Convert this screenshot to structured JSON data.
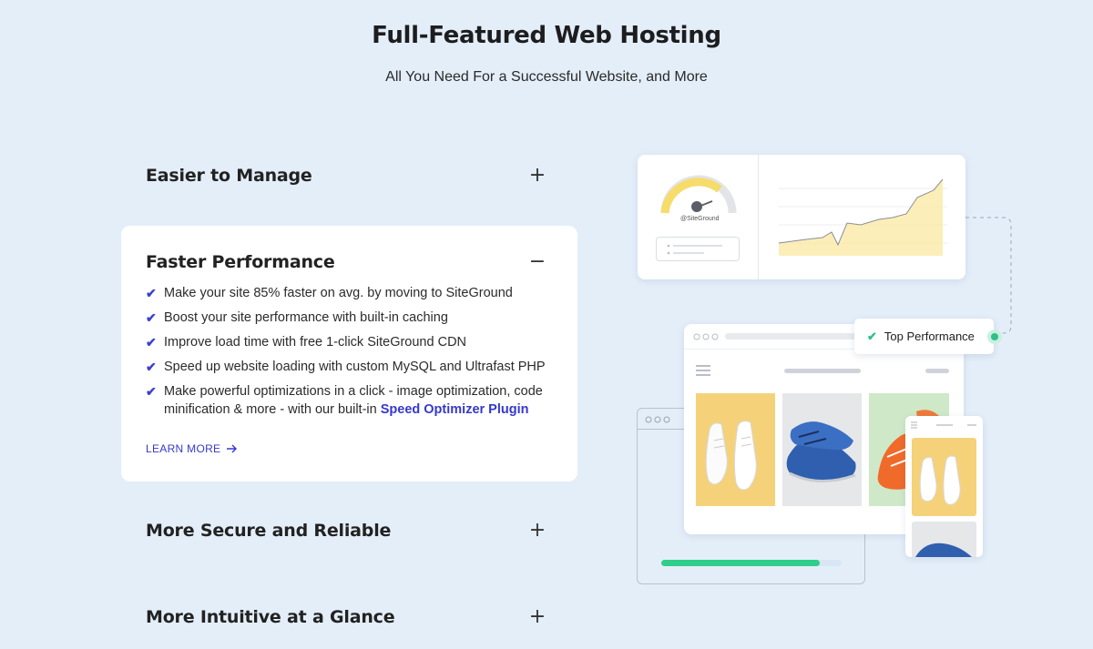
{
  "header": {
    "title": "Full-Featured Web Hosting",
    "subtitle": "All You Need For a Successful Website, and More"
  },
  "accordion": [
    {
      "title": "Easier to Manage",
      "sign": "+"
    },
    {
      "title": "Faster Performance",
      "sign": "−"
    },
    {
      "title": "More Secure and Reliable",
      "sign": "+"
    },
    {
      "title": "More Intuitive at a Glance",
      "sign": "+"
    }
  ],
  "expanded": {
    "features": [
      "Make your site 85% faster on avg. by moving to SiteGround",
      "Boost your site performance with built-in caching",
      "Improve load time with free 1-click SiteGround CDN",
      "Speed up website loading with custom MySQL and Ultrafast PHP"
    ],
    "last_feature_prefix": "Make powerful optimizations in a click - image optimization, code minification & more - with our built-in ",
    "last_feature_link": "Speed Optimizer Plugin",
    "learn_more": "LEARN MORE",
    "check_icon": "✔"
  },
  "illustration": {
    "gauge_brand": "@SiteGround",
    "badge_text": "Top Performance",
    "progress_fraction": 0.88,
    "colors": {
      "accent": "#3538cd",
      "gauge": "#f6dc6a",
      "green": "#2fce8c"
    }
  }
}
